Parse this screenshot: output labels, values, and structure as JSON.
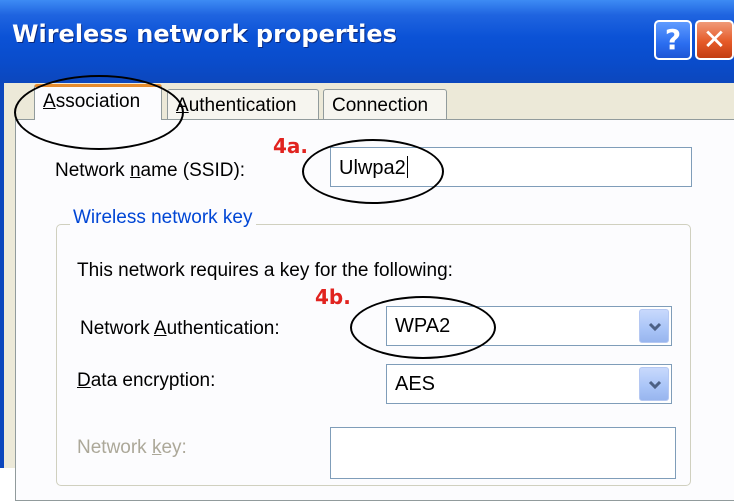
{
  "window": {
    "title": "Wireless network properties",
    "help_label": "?",
    "close_label": "✕"
  },
  "tabs": [
    {
      "label_first": "A",
      "label_rest": "ssociation",
      "selected": true
    },
    {
      "label_first": "A",
      "label_rest": "uthentication",
      "selected": false
    },
    {
      "label": "Connection",
      "selected": false
    }
  ],
  "association": {
    "ssid_label_pre": "Network ",
    "ssid_label_u": "n",
    "ssid_label_post": "ame (SSID):",
    "ssid_value": "Ulwpa2",
    "group_title": "Wireless network key",
    "key_requirement_text": "This network requires a key for the following:",
    "auth_label_pre": "Network ",
    "auth_label_u": "A",
    "auth_label_post": "uthentication:",
    "auth_value": "WPA2",
    "enc_label_u": "D",
    "enc_label_post": "ata encryption:",
    "enc_value": "AES",
    "netkey_label_pre": "Network ",
    "netkey_label_u": "k",
    "netkey_label_post": "ey:"
  },
  "annotations": {
    "step_a": "4a.",
    "step_b": "4b."
  },
  "colors": {
    "title_bar": "#0b52d6",
    "dialog_bg": "#ece9d8",
    "group_title": "#0046d5",
    "annotation": "#e1231f",
    "tab_highlight": "#e68b2c"
  }
}
